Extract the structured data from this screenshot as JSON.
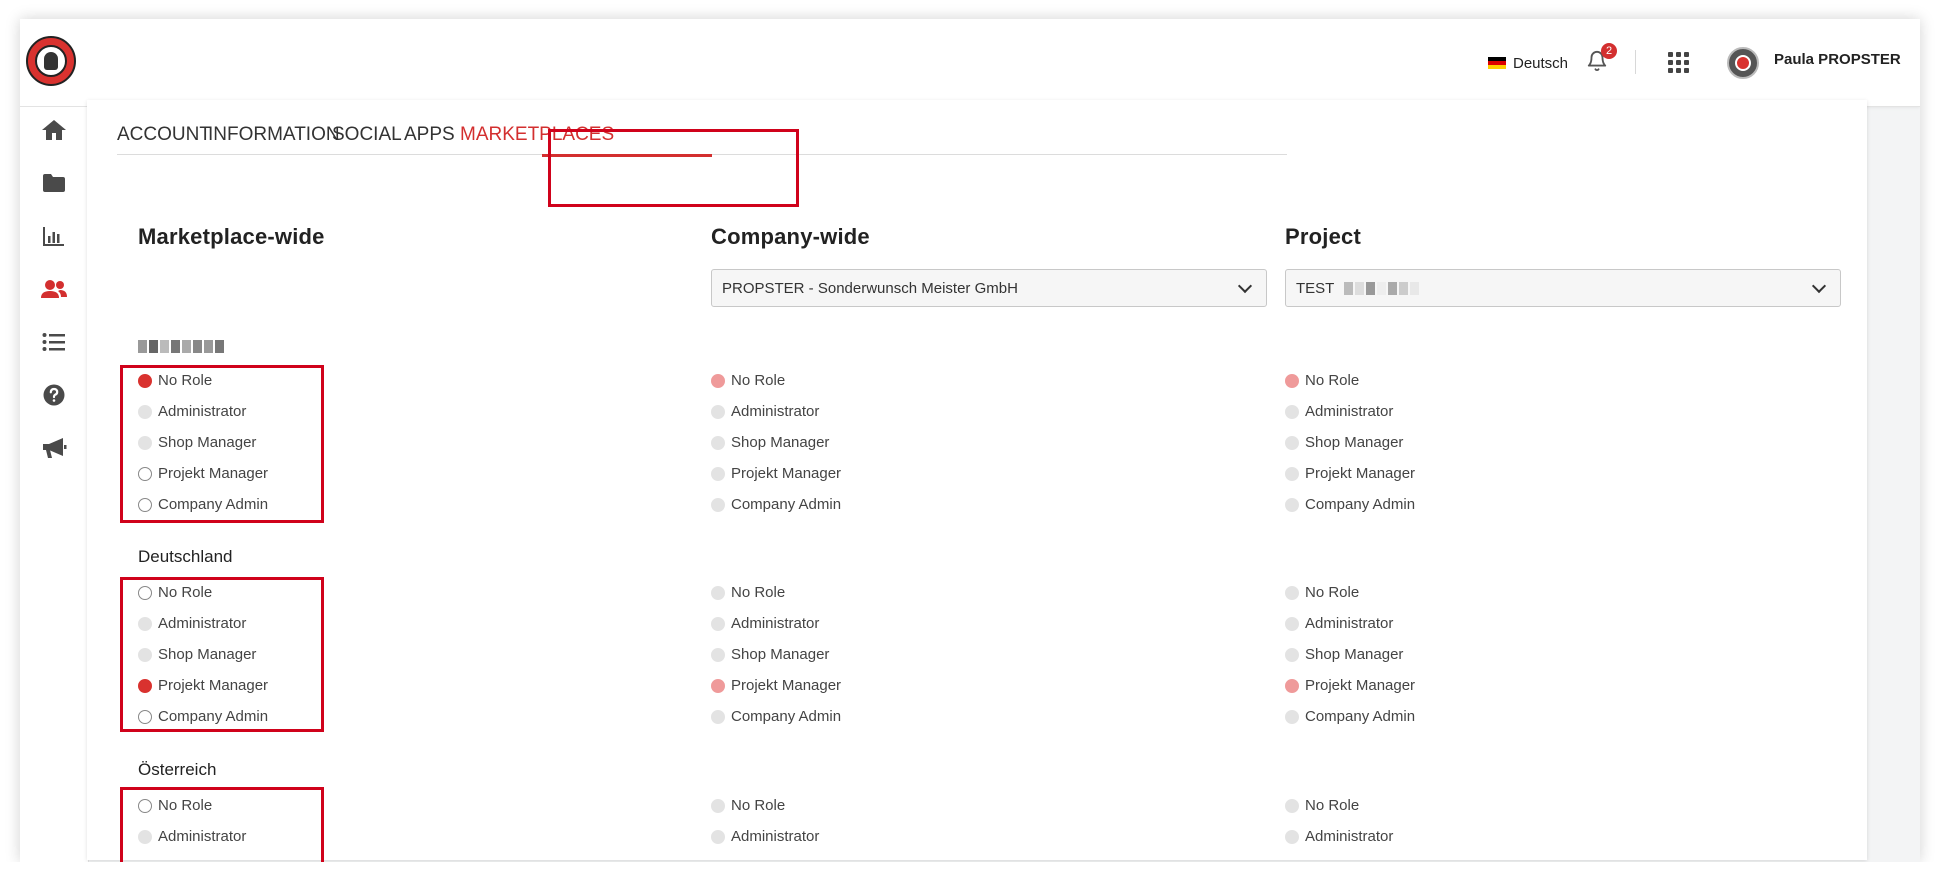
{
  "header": {
    "language": "Deutsch",
    "notification_count": "2",
    "user_name": "Paula PROPSTER"
  },
  "sidebar": {
    "items": [
      {
        "icon": "home-icon"
      },
      {
        "icon": "folder-icon"
      },
      {
        "icon": "bar-chart-icon"
      },
      {
        "icon": "users-icon",
        "active": true
      },
      {
        "icon": "list-icon"
      },
      {
        "icon": "help-icon"
      },
      {
        "icon": "megaphone-icon"
      }
    ]
  },
  "tabs": [
    {
      "label": "ACCOUNT"
    },
    {
      "label": "INFORMATION"
    },
    {
      "label": "SOCIAL"
    },
    {
      "label": "APPS"
    },
    {
      "label": "MARKETPLACES",
      "active": true
    }
  ],
  "columns": {
    "marketplace_title": "Marketplace-wide",
    "company_title": "Company-wide",
    "project_title": "Project",
    "company_select_value": "PROPSTER - Sonderwunsch Meister GmbH",
    "project_select_value": "TEST"
  },
  "role_options": [
    "No Role",
    "Administrator",
    "Shop Manager",
    "Projekt Manager",
    "Company Admin"
  ],
  "groups": [
    {
      "label": "",
      "selected": "No Role"
    },
    {
      "label": "Deutschland",
      "selected": "Projekt Manager"
    },
    {
      "label": "Österreich",
      "selected": ""
    }
  ],
  "colors": {
    "accent": "#d32f2f",
    "highlight_box": "#d0021b"
  }
}
